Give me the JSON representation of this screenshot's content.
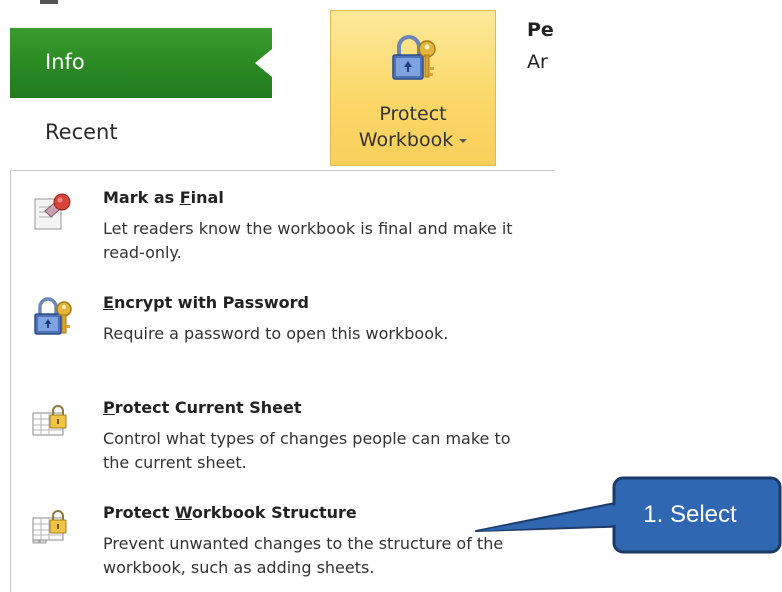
{
  "nav": {
    "items": [
      {
        "label": "Info",
        "active": true
      },
      {
        "label": "Recent",
        "active": false
      }
    ]
  },
  "protect_button": {
    "line1": "Protect",
    "line2": "Workbook",
    "icon": "lock-key-icon"
  },
  "side_panel": {
    "heading": "Pe",
    "subtext": "Ar"
  },
  "menu": {
    "items": [
      {
        "title_pre": "Mark as ",
        "title_key": "F",
        "title_post": "inal",
        "description": "Let readers know the workbook is final and make it read-only.",
        "icon": "mark-final-icon"
      },
      {
        "title_pre": "",
        "title_key": "E",
        "title_post": "ncrypt with Password",
        "description": "Require a password to open this workbook.",
        "icon": "lock-key-icon"
      },
      {
        "title_pre": "",
        "title_key": "P",
        "title_post": "rotect Current Sheet",
        "description": "Control what types of changes people can make to the current sheet.",
        "icon": "protect-sheet-icon"
      },
      {
        "title_pre": "Protect ",
        "title_key": "W",
        "title_post": "orkbook Structure",
        "description": "Prevent unwanted changes to the structure of the workbook, such as adding sheets.",
        "icon": "protect-workbook-icon"
      }
    ]
  },
  "callout": {
    "label": "1. Select",
    "fill_color": "#2f67b3",
    "border_color": "#1e3a66"
  },
  "colors": {
    "nav_active": "#2c8a24",
    "button_highlight": "#fbd86a"
  }
}
